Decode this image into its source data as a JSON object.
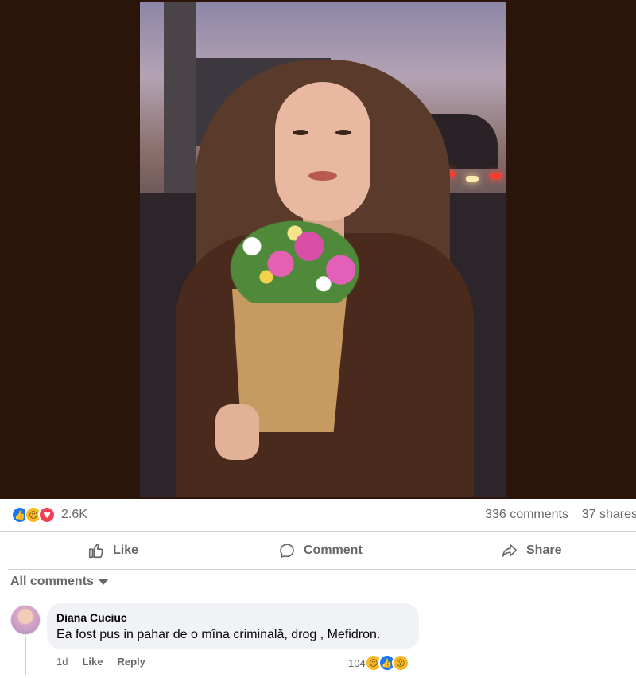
{
  "post": {
    "reactions": {
      "icons": [
        "like",
        "sad",
        "love"
      ],
      "count": "2.6K"
    },
    "comments_count": "336 comments",
    "shares_count": "37 shares"
  },
  "actions": {
    "like": "Like",
    "comment": "Comment",
    "share": "Share"
  },
  "comments_filter": "All comments",
  "comment": {
    "author": "Diana Cuciuc",
    "text": "Ea fost pus in pahar de o mîna criminală, drog , Mefidron.",
    "time": "1d",
    "like_label": "Like",
    "reply_label": "Reply",
    "reaction_count": "104",
    "reaction_icons": [
      "sad",
      "like",
      "wow"
    ]
  },
  "colors": {
    "accent": "#1877f2",
    "muted": "#65676b",
    "bubble": "#f0f2f5",
    "media_bg": "#2b1409"
  }
}
